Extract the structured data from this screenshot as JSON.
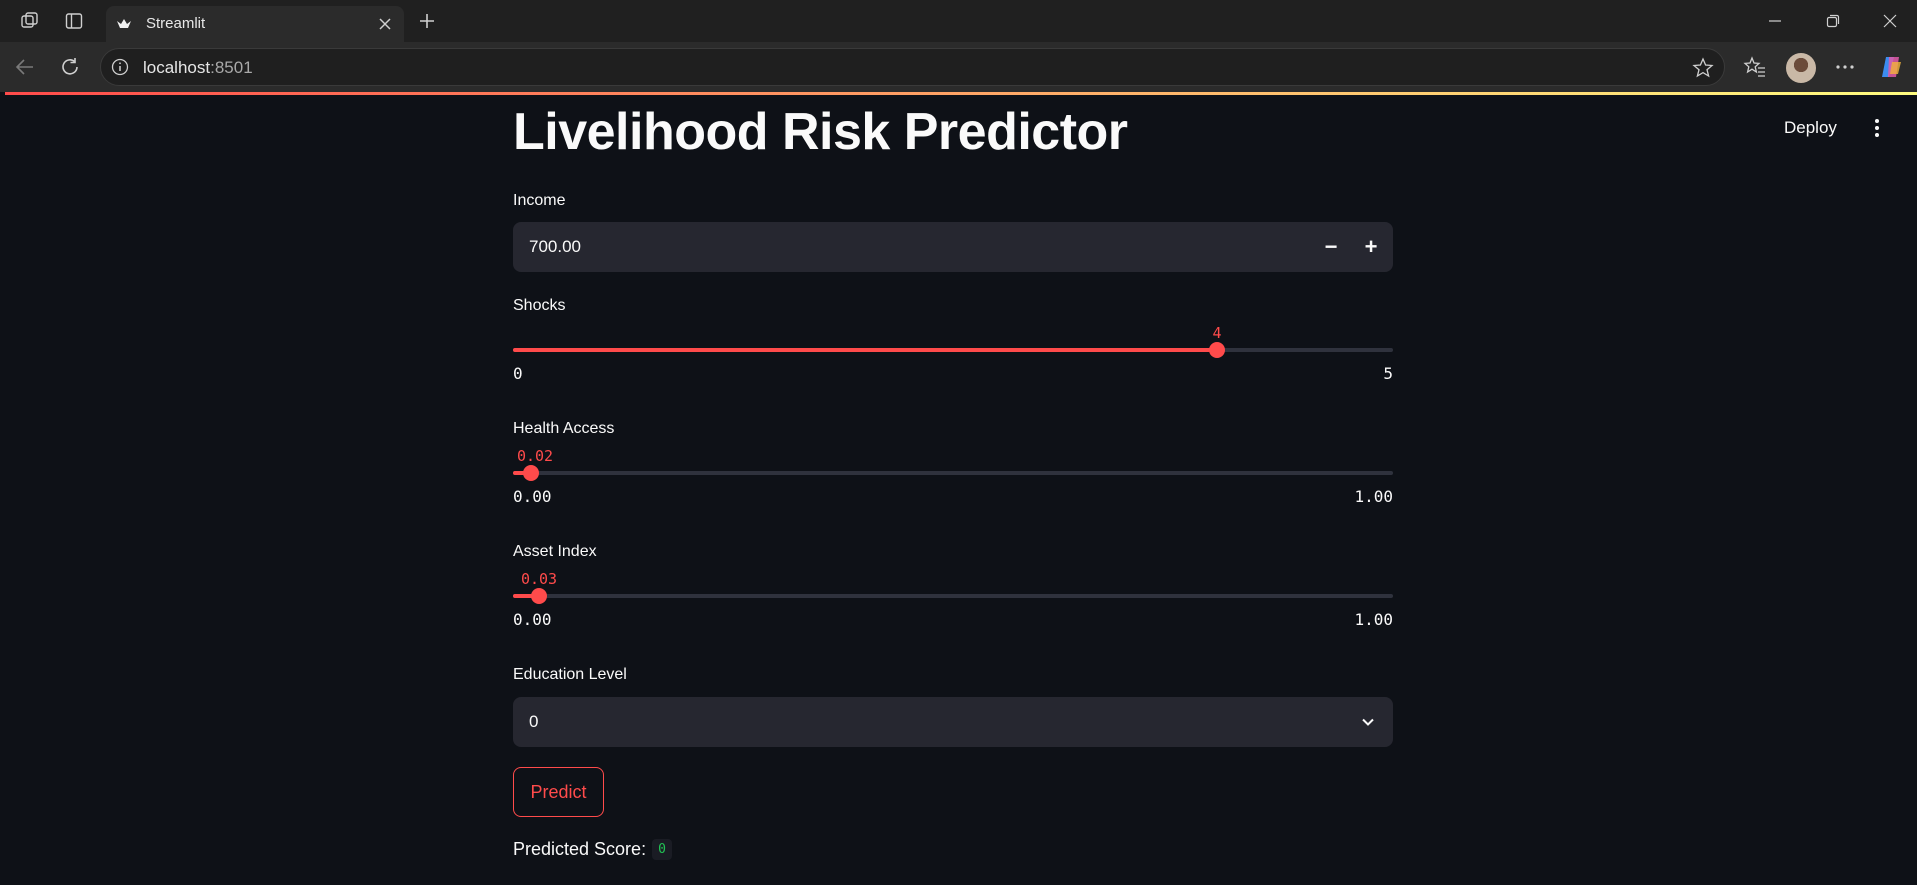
{
  "browser": {
    "tab_title": "Streamlit",
    "url_host": "localhost",
    "url_port": ":8501"
  },
  "app": {
    "deploy_label": "Deploy",
    "title": "Livelihood Risk Predictor",
    "income": {
      "label": "Income",
      "value": "700.00",
      "minus": "−",
      "plus": "+"
    },
    "shocks": {
      "label": "Shocks",
      "value": "4",
      "min": "0",
      "max": "5",
      "fraction": 0.8
    },
    "health_access": {
      "label": "Health Access",
      "value": "0.02",
      "min": "0.00",
      "max": "1.00",
      "fraction": 0.02
    },
    "asset_index": {
      "label": "Asset Index",
      "value": "0.03",
      "min": "0.00",
      "max": "1.00",
      "fraction": 0.03
    },
    "education_level": {
      "label": "Education Level",
      "value": "0"
    },
    "predict_label": "Predict",
    "result_label": "Predicted Score:",
    "result_value": "0"
  },
  "colors": {
    "accent": "#ff4b4b",
    "background": "#0e1117",
    "widget_bg": "#262730",
    "success_code": "#21c354"
  },
  "icons": [
    "workspaces-icon",
    "vertical-tabs-icon",
    "streamlit-favicon",
    "close-icon",
    "plus-icon",
    "minimize-icon",
    "restore-icon",
    "window-close-icon",
    "back-arrow-icon",
    "refresh-icon",
    "info-icon",
    "star-icon",
    "favorites-icon",
    "more-icon",
    "copilot-icon",
    "kebab-menu-icon",
    "chevron-down-icon"
  ]
}
